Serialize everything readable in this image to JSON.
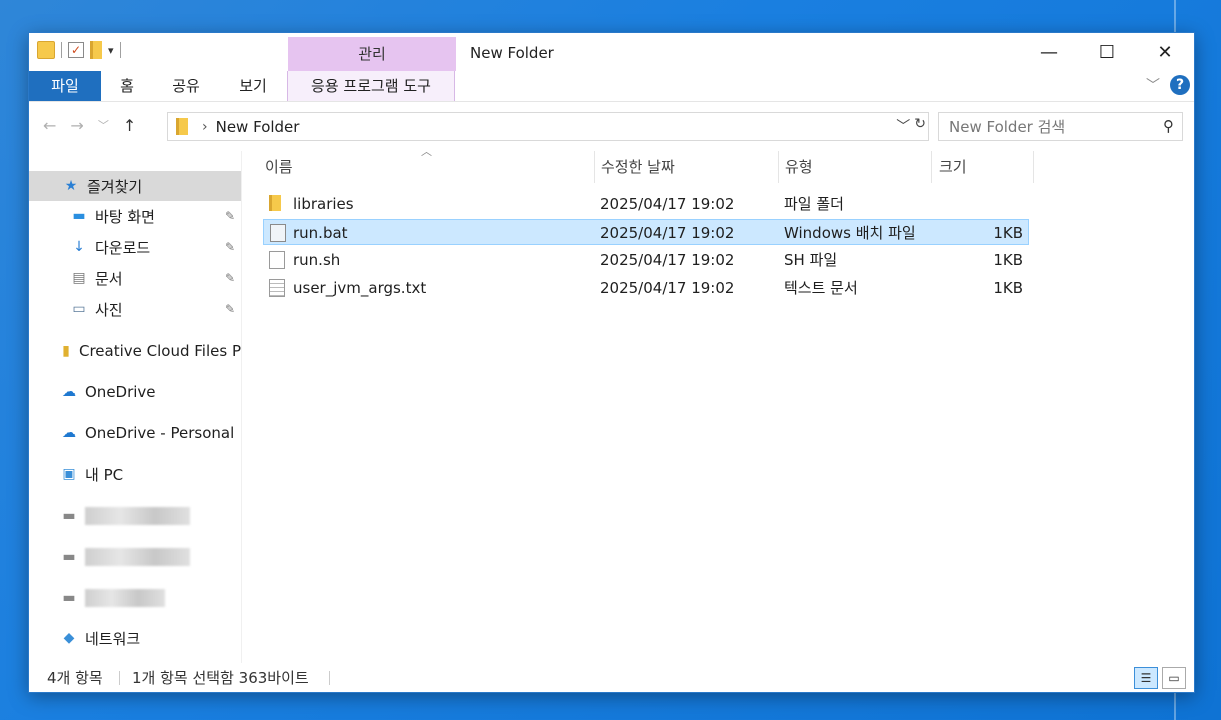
{
  "window": {
    "title": "New Folder",
    "context_tab_group": "관리",
    "minimize": "—",
    "maximize": "☐",
    "close": "✕"
  },
  "ribbon": {
    "tabs": [
      "파일",
      "홈",
      "공유",
      "보기",
      "응용 프로그램 도구"
    ]
  },
  "address": {
    "path": "New Folder",
    "search_placeholder": "New Folder 검색"
  },
  "navigation": {
    "quick_access": "즐겨찾기",
    "pinned": [
      {
        "label": "바탕 화면",
        "icon": "desktop-icon"
      },
      {
        "label": "다운로드",
        "icon": "download-icon"
      },
      {
        "label": "문서",
        "icon": "documents-icon"
      },
      {
        "label": "사진",
        "icon": "pictures-icon"
      }
    ],
    "creative_cloud": "Creative Cloud Files P",
    "onedrive": "OneDrive",
    "onedrive_personal": "OneDrive - Personal",
    "this_pc": "내 PC",
    "network": "네트워크"
  },
  "columns": {
    "name": "이름",
    "date": "수정한 날짜",
    "type": "유형",
    "size": "크기"
  },
  "files": [
    {
      "name": "libraries",
      "date": "2025/04/17 19:02",
      "type": "파일 폴더",
      "size": "",
      "icon": "folder-icon"
    },
    {
      "name": "run.bat",
      "date": "2025/04/17 19:02",
      "type": "Windows 배치 파일",
      "size": "1KB",
      "icon": "batch-file-icon"
    },
    {
      "name": "run.sh",
      "date": "2025/04/17 19:02",
      "type": "SH 파일",
      "size": "1KB",
      "icon": "file-icon"
    },
    {
      "name": "user_jvm_args.txt",
      "date": "2025/04/17 19:02",
      "type": "텍스트 문서",
      "size": "1KB",
      "icon": "text-file-icon"
    }
  ],
  "status": {
    "count": "4개 항목",
    "selection": "1개 항목 선택함 363바이트"
  },
  "colors": {
    "accent": "#1f6fbf",
    "selection": "#cce8ff",
    "context_tab": "#e6c4f0"
  }
}
